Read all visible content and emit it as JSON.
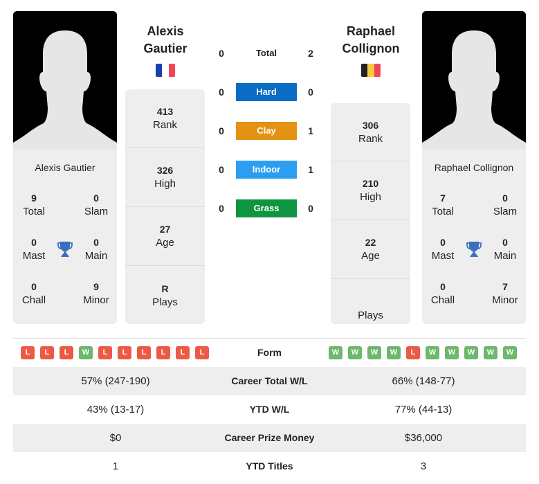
{
  "players": {
    "left": {
      "name": "Alexis Gautier",
      "first_name": "Alexis",
      "last_name": "Gautier",
      "country_flag": "france-flag",
      "flag_colors": [
        "#1a3fb0",
        "#ffffff",
        "#f0455a"
      ],
      "titles": {
        "total": {
          "value": "9",
          "label": "Total"
        },
        "slam": {
          "value": "0",
          "label": "Slam"
        },
        "mast": {
          "value": "0",
          "label": "Mast"
        },
        "main": {
          "value": "0",
          "label": "Main"
        },
        "chall": {
          "value": "0",
          "label": "Chall"
        },
        "minor": {
          "value": "9",
          "label": "Minor"
        }
      },
      "rank": {
        "value": "413",
        "label": "Rank"
      },
      "high": {
        "value": "326",
        "label": "High"
      },
      "age": {
        "value": "27",
        "label": "Age"
      },
      "plays": {
        "value": "R",
        "label": "Plays"
      },
      "form": [
        "L",
        "L",
        "L",
        "W",
        "L",
        "L",
        "L",
        "L",
        "L",
        "L"
      ]
    },
    "right": {
      "name": "Raphael Collignon",
      "first_name": "Raphael",
      "last_name": "Collignon",
      "country_flag": "belgium-flag",
      "flag_colors": [
        "#222222",
        "#f7cd3e",
        "#f0455a"
      ],
      "titles": {
        "total": {
          "value": "7",
          "label": "Total"
        },
        "slam": {
          "value": "0",
          "label": "Slam"
        },
        "mast": {
          "value": "0",
          "label": "Mast"
        },
        "main": {
          "value": "0",
          "label": "Main"
        },
        "chall": {
          "value": "0",
          "label": "Chall"
        },
        "minor": {
          "value": "7",
          "label": "Minor"
        }
      },
      "rank": {
        "value": "306",
        "label": "Rank"
      },
      "high": {
        "value": "210",
        "label": "High"
      },
      "age": {
        "value": "22",
        "label": "Age"
      },
      "plays": {
        "value": "",
        "label": "Plays"
      },
      "form": [
        "W",
        "W",
        "W",
        "W",
        "L",
        "W",
        "W",
        "W",
        "W",
        "W"
      ]
    }
  },
  "h2h": [
    {
      "label": "Total",
      "left": "0",
      "right": "2",
      "color": ""
    },
    {
      "label": "Hard",
      "left": "0",
      "right": "0",
      "color": "#0a6cc4"
    },
    {
      "label": "Clay",
      "left": "0",
      "right": "1",
      "color": "#e39212"
    },
    {
      "label": "Indoor",
      "left": "0",
      "right": "1",
      "color": "#2b9ef2"
    },
    {
      "label": "Grass",
      "left": "0",
      "right": "0",
      "color": "#0f953f"
    }
  ],
  "comparison": {
    "form_label": "Form",
    "rows": [
      {
        "label": "Career Total W/L",
        "left": "57% (247-190)",
        "right": "66% (148-77)"
      },
      {
        "label": "YTD W/L",
        "left": "43% (13-17)",
        "right": "77% (44-13)"
      },
      {
        "label": "Career Prize Money",
        "left": "$0",
        "right": "$36,000"
      },
      {
        "label": "YTD Titles",
        "left": "1",
        "right": "3"
      }
    ]
  },
  "colors": {
    "win": "#6cb86c",
    "loss": "#ec5a45",
    "trophy": "#3a6fbf",
    "panel_bg": "#eeeeee"
  }
}
